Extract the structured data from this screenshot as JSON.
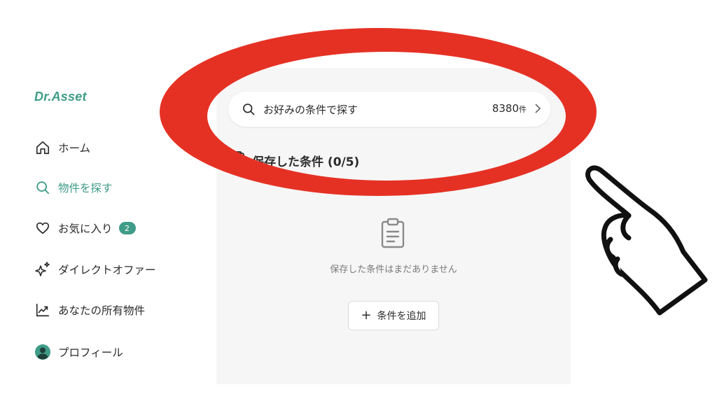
{
  "brand": {
    "logo": "Dr.Asset",
    "accent": "#3f9c88"
  },
  "sidebar": {
    "items": [
      {
        "label": "ホーム",
        "icon": "home-icon"
      },
      {
        "label": "物件を探す",
        "icon": "search-icon",
        "active": true
      },
      {
        "label": "お気に入り",
        "icon": "heart-icon",
        "badge": "2"
      },
      {
        "label": "ダイレクトオファー",
        "icon": "sparkle-icon"
      },
      {
        "label": "あなたの所有物件",
        "icon": "chart-icon"
      },
      {
        "label": "プロフィール",
        "icon": "avatar-icon"
      }
    ]
  },
  "search": {
    "placeholder": "お好みの条件で探す",
    "count": "8380",
    "count_unit": "件"
  },
  "saved": {
    "title": "保存した条件 (0/5)",
    "empty_message": "保存した条件はまだありません",
    "add_button": "条件を追加"
  },
  "annotation": {
    "ellipse_color": "#e53124",
    "pointer": "pointing-hand-icon"
  }
}
